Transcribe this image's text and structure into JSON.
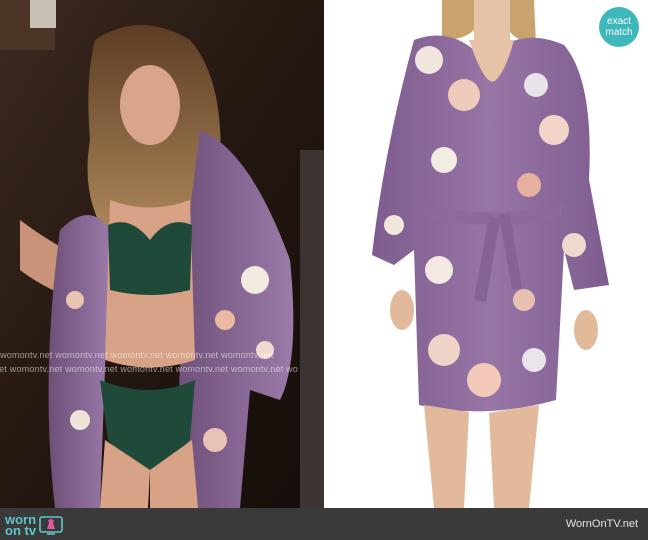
{
  "badge": {
    "line1": "exact",
    "line2": "match"
  },
  "watermark": {
    "row1": "womontv.net  womontv.net  womontv.net  womontv.net  womontv.net",
    "row2": "net  womontv.net  womontv.net  womontv.net  womontv.net  womontv.net  wo"
  },
  "footer": {
    "logo_top": "worn",
    "logo_bottom": "on tv",
    "site": "WornOnTV.net"
  },
  "colors": {
    "teal": "#3fb8bc",
    "footer_bg": "#3a3a3a",
    "robe": "#8d6a9c"
  },
  "icons": {
    "badge": "exact-match-badge",
    "tv": "dress-tv-icon"
  }
}
